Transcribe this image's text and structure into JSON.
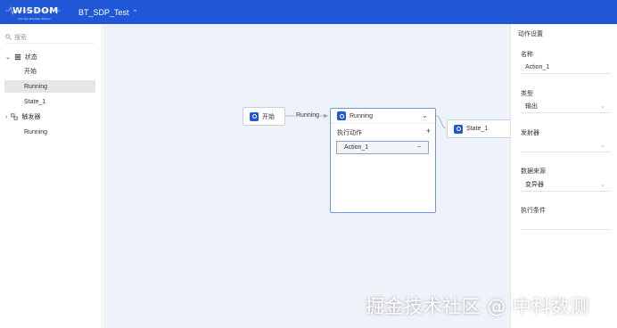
{
  "header": {
    "logo_text": "WISDOM",
    "logo_tagline": "Your Eye Exquisite Wisdom",
    "project_name": "BT_SDP_Test",
    "bg_color": "#1f57d6"
  },
  "sidebar": {
    "search_placeholder": "搜索",
    "groups": [
      {
        "label": "状态",
        "icon": "state-list-icon",
        "children": [
          "开始",
          "Running",
          "State_1"
        ],
        "selected": "Running"
      },
      {
        "label": "触发器",
        "icon": "trigger-icon",
        "children": [
          "Running"
        ]
      }
    ]
  },
  "canvas": {
    "nodes": {
      "start": "开始",
      "running": "Running",
      "state1": "State_1"
    },
    "edge_label": "Running",
    "running_card": {
      "actions_label": "执行动作",
      "add_symbol": "+",
      "action_item": "Action_1",
      "remove_symbol": "−"
    }
  },
  "panel": {
    "title": "动作设置",
    "name_label": "名称",
    "name_value": "Action_1",
    "type_label": "类型",
    "type_value": "输出",
    "sender_label": "发射器",
    "sender_value": "",
    "datasource_label": "数据来源",
    "datasource_value": "变异器",
    "condition_label": "执行条件",
    "condition_value": ""
  },
  "watermark": "掘金技术社区 @ 中科数测"
}
